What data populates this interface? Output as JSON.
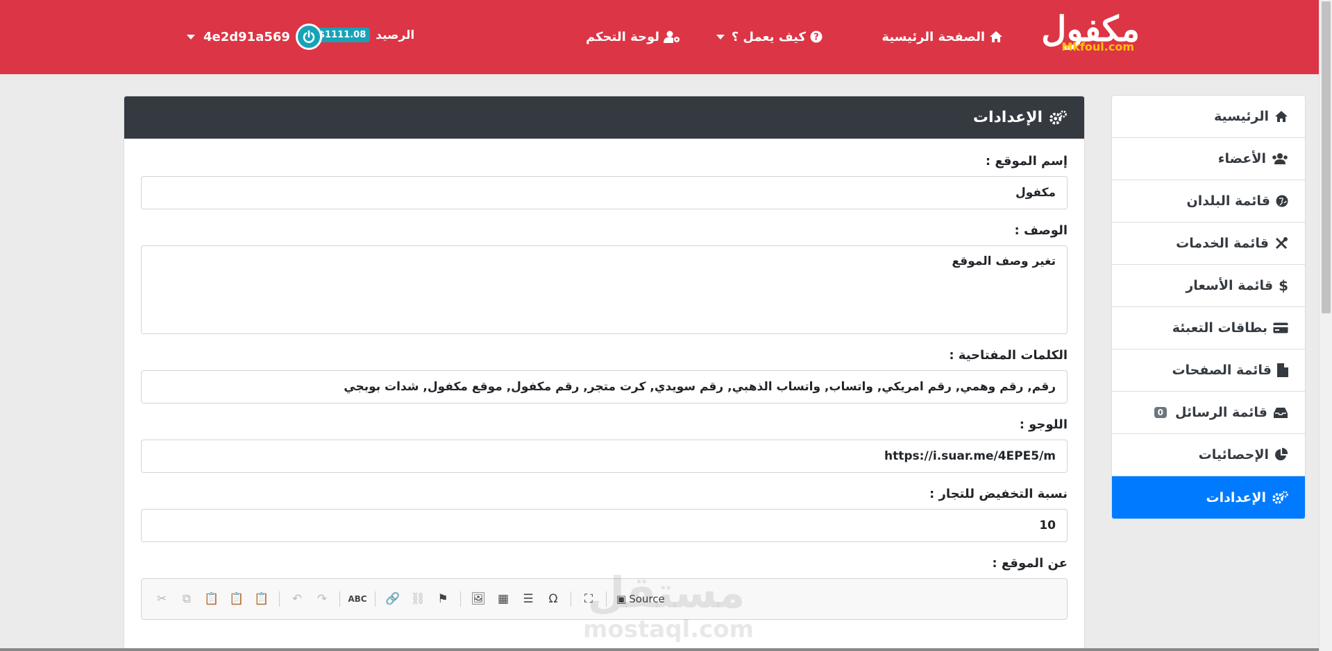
{
  "navbar": {
    "brand_ar": "مكفول",
    "brand_en": "Mkfoul.com",
    "home": "الصفحة الرئيسية",
    "how": "كيف يعمل ؟",
    "dashboard": "لوحة التحكم",
    "balance_label": "الرصيد",
    "balance_value": "$1111.08",
    "user": "4e2d91a569"
  },
  "sidebar": {
    "items": [
      {
        "label": "الرئيسية",
        "icon": "home-icon"
      },
      {
        "label": "الأعضاء",
        "icon": "users-icon"
      },
      {
        "label": "قائمة البلدان",
        "icon": "globe-icon"
      },
      {
        "label": "قائمة الخدمات",
        "icon": "tools-icon"
      },
      {
        "label": "قائمة الأسعار",
        "icon": "dollar-icon"
      },
      {
        "label": "بطاقات التعبئة",
        "icon": "credit-card-icon"
      },
      {
        "label": "قائمة الصفحات",
        "icon": "file-icon"
      },
      {
        "label": "قائمة الرسائل",
        "icon": "inbox-icon",
        "count": "0"
      },
      {
        "label": "الإحصائيات",
        "icon": "pie-chart-icon"
      },
      {
        "label": "الإعدادات",
        "icon": "cogs-icon",
        "active": true
      }
    ]
  },
  "settings": {
    "title": "الإعدادات",
    "site_name_label": "إسم الموقع :",
    "site_name_value": "مكفول",
    "description_label": "الوصف :",
    "description_value": "تغير وصف الموقع",
    "keywords_label": "الكلمات المفتاحية :",
    "keywords_value": "رقم, رقم وهمي, رقم امريكي, واتساب, واتساب الذهبي, رقم سويدي, كرت متجر, رقم مكفول, موقع مكفول, شدات بوبجي",
    "logo_label": "اللوجو :",
    "logo_value": "https://i.suar.me/4EPE5/m",
    "discount_label": "نسبة التخفيض للتجار :",
    "discount_value": "10",
    "about_label": "عن الموقع :",
    "editor_source": "Source"
  },
  "watermark": {
    "ar": "مستقل",
    "en": "mostaql.com"
  },
  "colors": {
    "navbar": "#dc3545",
    "card_header": "#343a40",
    "active": "#007bff",
    "badge": "#17a2b8",
    "brand_accent": "#ffc107"
  }
}
